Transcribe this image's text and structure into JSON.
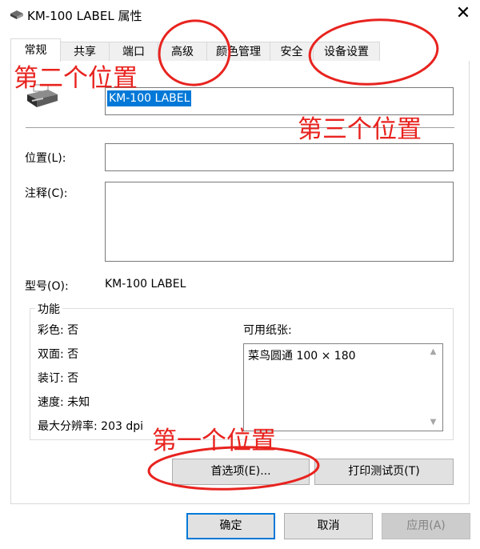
{
  "window": {
    "title": "KM-100 LABEL 属性",
    "close_label": "✕"
  },
  "tabs": [
    {
      "label": "常规",
      "active": true
    },
    {
      "label": "共享"
    },
    {
      "label": "端口"
    },
    {
      "label": "高级"
    },
    {
      "label": "颜色管理"
    },
    {
      "label": "安全"
    },
    {
      "label": "设备设置"
    }
  ],
  "printer_name": "KM-100 LABEL",
  "location": {
    "label": "位置(L):",
    "value": ""
  },
  "comment": {
    "label": "注释(C):",
    "value": ""
  },
  "model": {
    "label": "型号(O):",
    "value": "KM-100 LABEL"
  },
  "features": {
    "title": "功能",
    "color": "彩色: 否",
    "duplex": "双面: 否",
    "staple": "装订: 否",
    "speed": "速度: 未知",
    "max_resolution": "最大分辨率: 203 dpi",
    "paper_label": "可用纸张:",
    "papers": [
      "菜鸟圆通 100 × 180"
    ]
  },
  "buttons": {
    "preferences": "首选项(E)...",
    "print_test_page": "打印测试页(T)",
    "ok": "确定",
    "cancel": "取消",
    "apply": "应用(A)"
  },
  "annotations": {
    "first": "第一个位置",
    "second": "第二个位置",
    "third": "第三个位置"
  },
  "colors": {
    "annotation": "#e8231f",
    "selection": "#0078d7",
    "default_button_border": "#0078d7"
  },
  "icons": {
    "title_icon": "printer-icon",
    "printer_image": "printer-icon"
  }
}
